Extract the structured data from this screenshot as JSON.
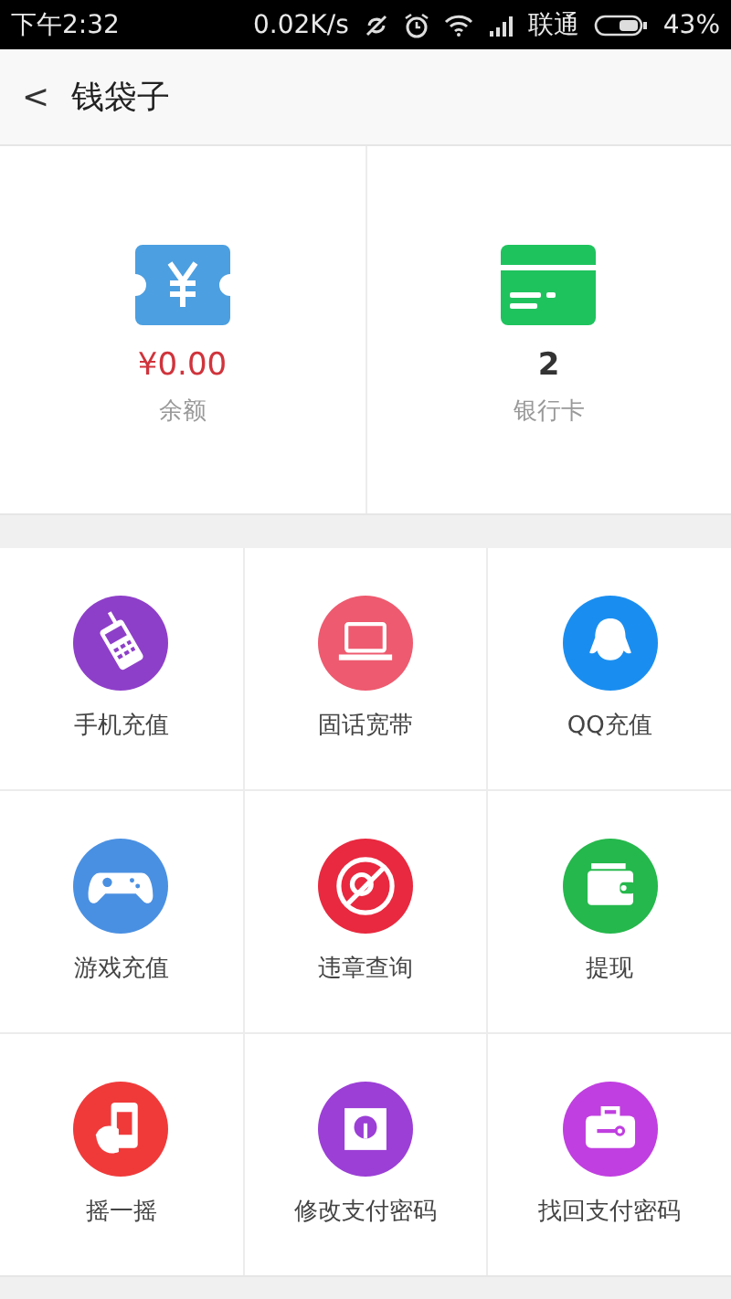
{
  "status_bar": {
    "time": "下午2:32",
    "speed": "0.02K/s",
    "carrier": "联通",
    "battery": "43%"
  },
  "header": {
    "back": "<",
    "title": "钱袋子"
  },
  "summary": [
    {
      "value": "¥0.00",
      "label": "余额",
      "kind": "balance"
    },
    {
      "value": "2",
      "label": "银行卡",
      "kind": "cards"
    }
  ],
  "services": [
    {
      "label": "手机充值",
      "color": "#8e3fc9"
    },
    {
      "label": "固话宽带",
      "color": "#ee5a6f"
    },
    {
      "label": "QQ充值",
      "color": "#1a8ef0"
    },
    {
      "label": "游戏充值",
      "color": "#4a90e2"
    },
    {
      "label": "违章查询",
      "color": "#e8293f"
    },
    {
      "label": "提现",
      "color": "#25b84c"
    },
    {
      "label": "摇一摇",
      "color": "#f03a3a"
    },
    {
      "label": "修改支付密码",
      "color": "#9b3fd6"
    },
    {
      "label": "找回支付密码",
      "color": "#c03fe0"
    }
  ]
}
